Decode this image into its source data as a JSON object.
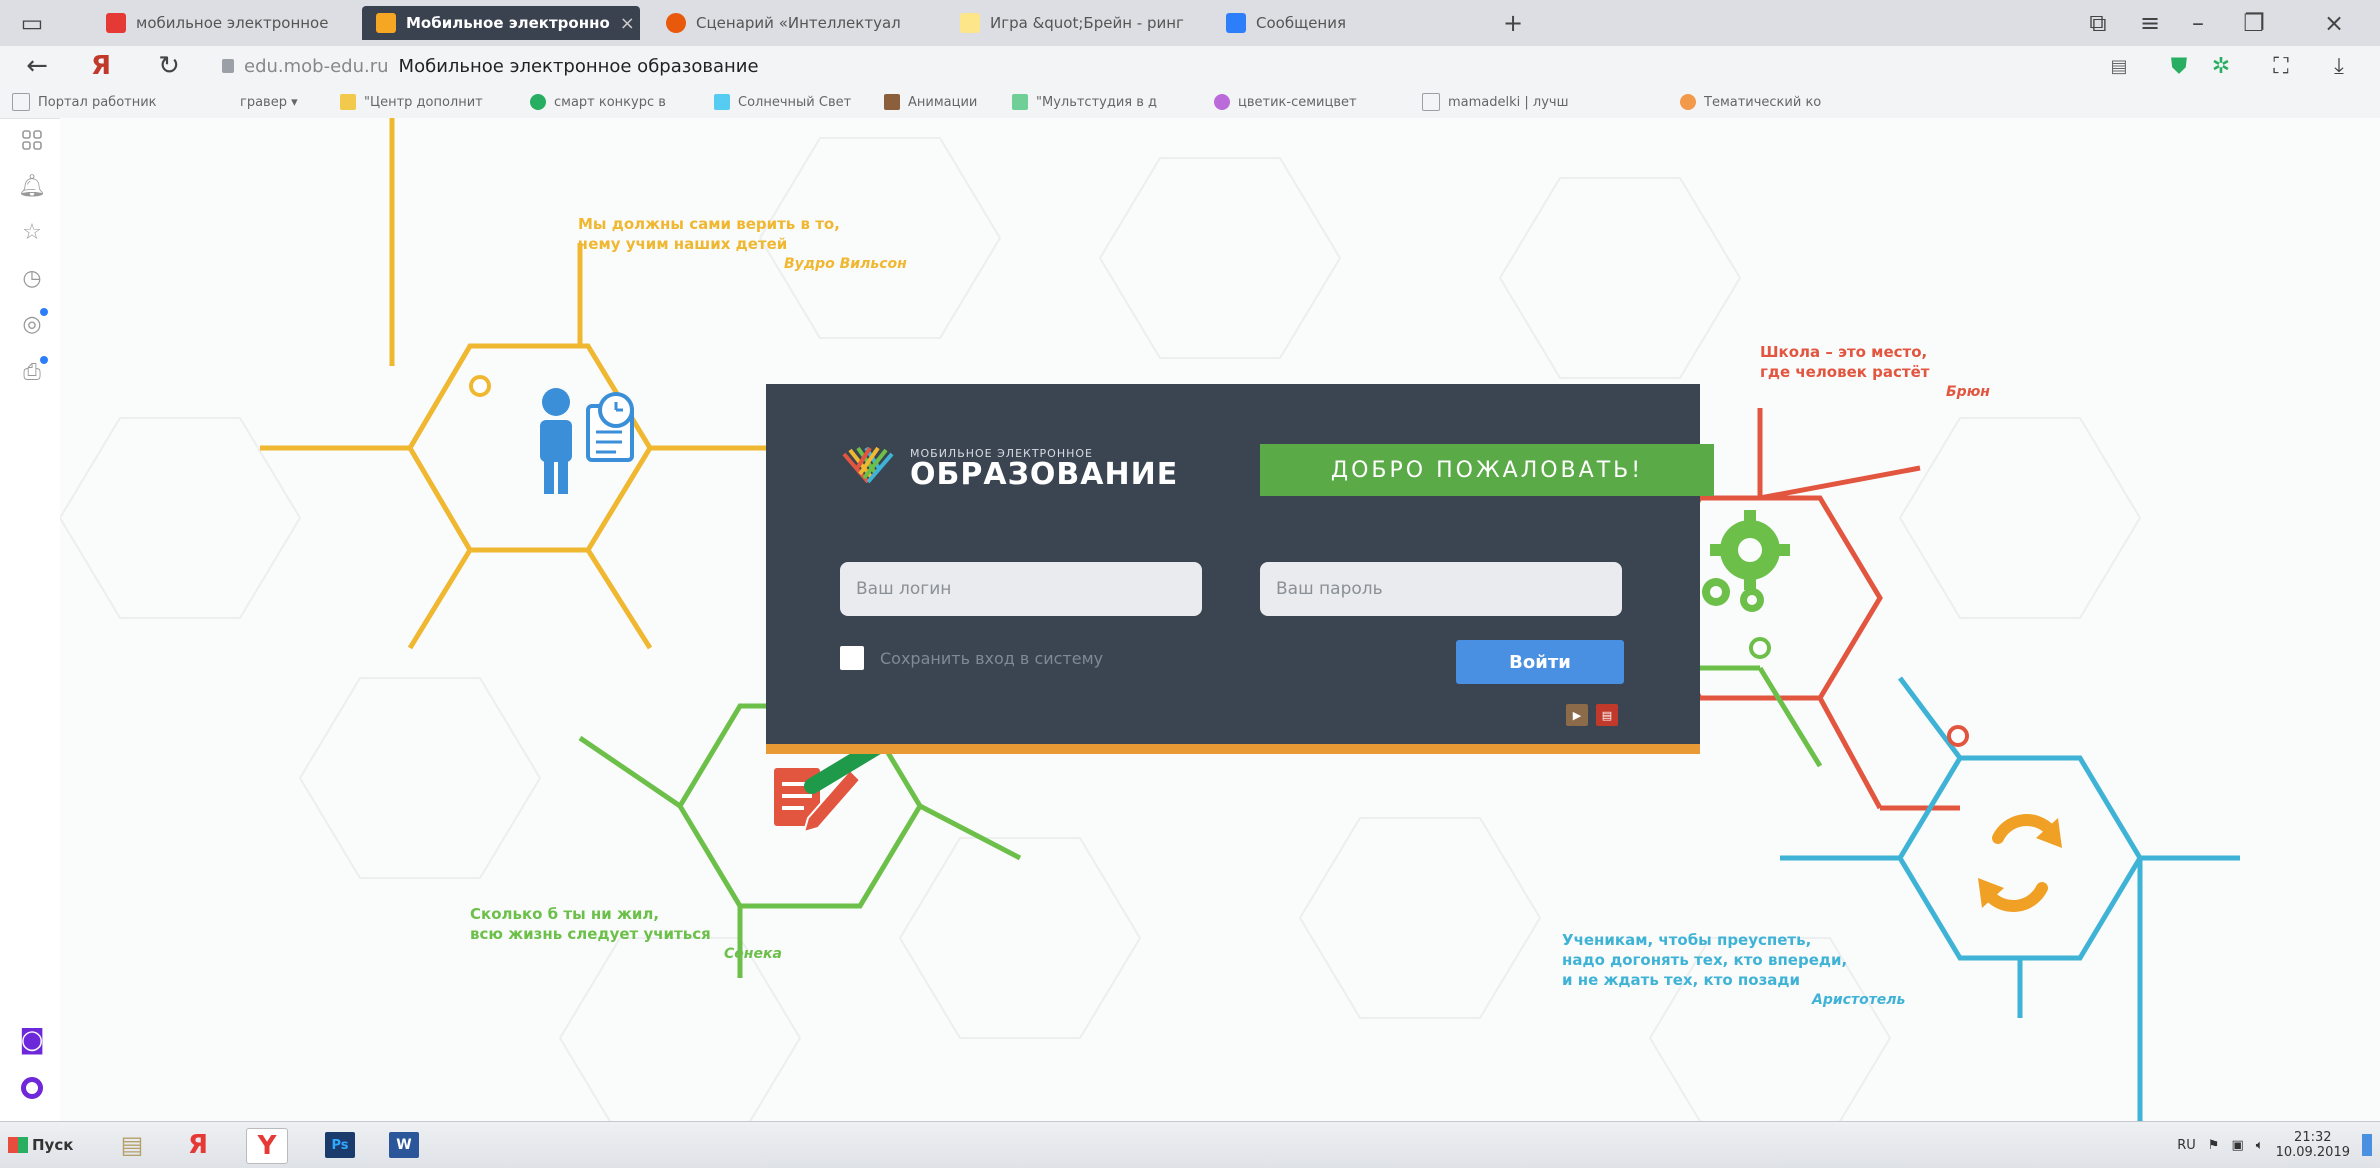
{
  "browser": {
    "tabs": [
      {
        "label": "мобильное электронное",
        "icon": "yandex-icon",
        "active": false,
        "color": "#e53935"
      },
      {
        "label": "Мобильное электронно",
        "icon": "moe-logo-icon",
        "active": true,
        "color": "#f5a623"
      },
      {
        "label": "Сценарий «Интеллектуал",
        "icon": "flame-icon",
        "active": false,
        "color": "#e8590c"
      },
      {
        "label": "Игра &quot;Брейн - ринг",
        "icon": "page-icon",
        "active": false,
        "color": "#fde68a"
      },
      {
        "label": "Сообщения",
        "icon": "chat-icon",
        "active": false,
        "color": "#2d7ff9"
      }
    ],
    "new_tab": "+",
    "address": {
      "domain": "edu.mob-edu.ru",
      "page_title": "Мобильное электронное образование"
    },
    "bookmarks": [
      {
        "label": "Портал работник",
        "color": "#9aa0a6"
      },
      {
        "label": "гравер ▾",
        "color": "#9aa0a6"
      },
      {
        "label": "\"Центр дополнит",
        "color": "#f2c94c"
      },
      {
        "label": "смарт конкурс в",
        "color": "#27ae60"
      },
      {
        "label": "Солнечный Свет",
        "color": "#56ccf2"
      },
      {
        "label": "Анимации",
        "color": "#8b5e3c"
      },
      {
        "label": "\"Мультстудия в д",
        "color": "#6fcf97"
      },
      {
        "label": "цветик-семицвет",
        "color": "#bb6bd9"
      },
      {
        "label": "mamadelki | лучш",
        "color": "#9aa0a6"
      },
      {
        "label": "Тематический ко",
        "color": "#f2994a"
      }
    ]
  },
  "quotes": [
    {
      "text1": "Мы должны сами верить в то,",
      "text2": "чему учим наших детей",
      "author": "Вудро Вильсон",
      "color": "#f0b730"
    },
    {
      "text1": "Школа – это место,",
      "text2": "где человек растёт",
      "author": "Брюн",
      "color": "#e2553f"
    },
    {
      "text1": "Сколько б ты ни жил,",
      "text2": "всю жизнь следует учиться",
      "author": "Сенека",
      "color": "#6cc04a"
    },
    {
      "text1": "Ученикам, чтобы преуспеть,",
      "text2": "надо догонять тех, кто впереди,",
      "text3": "и не ждать тех, кто позади",
      "author": "Аристотель",
      "color": "#3fb3d6"
    }
  ],
  "login": {
    "brand_small": "МОБИЛЬНОЕ ЭЛЕКТРОННОЕ",
    "brand_big": "ОБРАЗОВАНИЕ",
    "welcome": "ДОБРО ПОЖАЛОВАТЬ!",
    "login_placeholder": "Ваш логин",
    "password_placeholder": "Ваш пароль",
    "remember_label": "Сохранить вход в систему",
    "submit_label": "Войти",
    "accent": "#e89b35"
  },
  "taskbar": {
    "start_label": "Пуск",
    "lang": "RU",
    "time": "21:32",
    "date": "10.09.2019"
  }
}
